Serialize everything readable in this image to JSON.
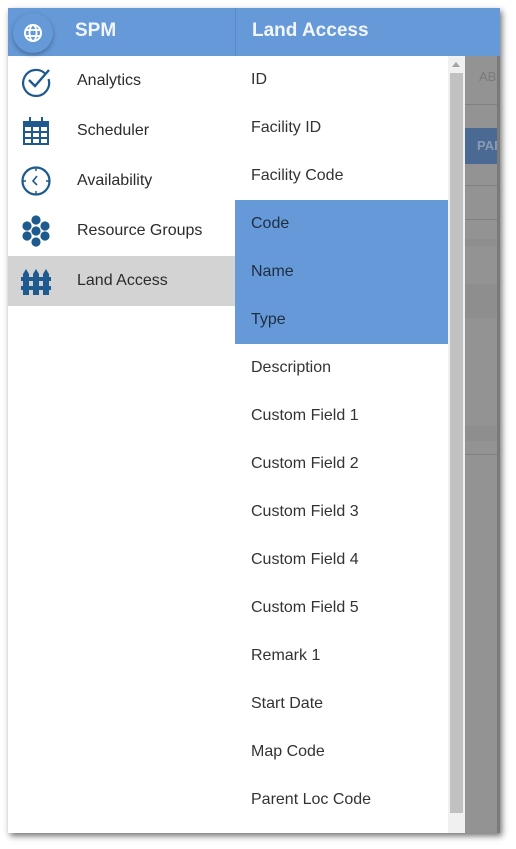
{
  "nav": {
    "title": "SPM",
    "globe_icon": "globe-icon",
    "items": [
      {
        "label": "Analytics",
        "icon": "check-circle-icon",
        "active": false
      },
      {
        "label": "Scheduler",
        "icon": "calendar-icon",
        "active": false
      },
      {
        "label": "Availability",
        "icon": "clock-icon",
        "active": false
      },
      {
        "label": "Resource Groups",
        "icon": "hexagon-cluster-icon",
        "active": false
      },
      {
        "label": "Land Access",
        "icon": "fence-icon",
        "active": true
      }
    ]
  },
  "panel": {
    "title": "Land Access",
    "fields": [
      {
        "label": "ID",
        "selected": false
      },
      {
        "label": "Facility ID",
        "selected": false
      },
      {
        "label": "Facility Code",
        "selected": false
      },
      {
        "label": "Code",
        "selected": true
      },
      {
        "label": "Name",
        "selected": true
      },
      {
        "label": "Type",
        "selected": true
      },
      {
        "label": "Description",
        "selected": false
      },
      {
        "label": "Custom Field 1",
        "selected": false
      },
      {
        "label": "Custom Field 2",
        "selected": false
      },
      {
        "label": "Custom Field 3",
        "selected": false
      },
      {
        "label": "Custom Field 4",
        "selected": false
      },
      {
        "label": "Custom Field 5",
        "selected": false
      },
      {
        "label": "Remark 1",
        "selected": false
      },
      {
        "label": "Start Date",
        "selected": false
      },
      {
        "label": "Map Code",
        "selected": false
      },
      {
        "label": "Parent Loc Code",
        "selected": false
      }
    ]
  },
  "backdrop": {
    "tab_text": "ABA",
    "button_text": "PAR"
  },
  "colors": {
    "accent": "#6699d8",
    "icon": "#1e5a8e",
    "active_bg": "#d3d3d3"
  }
}
